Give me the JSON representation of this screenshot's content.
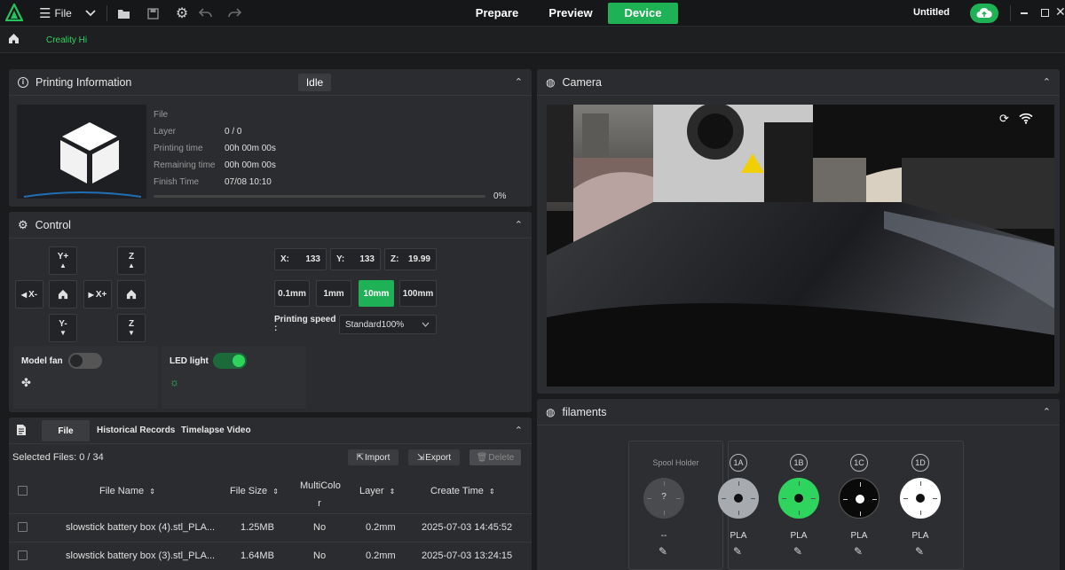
{
  "topbar": {
    "menu_label": "File",
    "tabs": [
      {
        "label": "Prepare"
      },
      {
        "label": "Preview"
      },
      {
        "label": "Device"
      }
    ],
    "project_title": "Untitled"
  },
  "subbar": {
    "printer_tab": "Creality Hi"
  },
  "printing_info": {
    "title": "Printing Information",
    "status": "Idle",
    "labels": {
      "file": "File",
      "layer": "Layer",
      "printing_time": "Printing time",
      "remaining_time": "Remaining time",
      "finish_time": "Finish Time"
    },
    "values": {
      "layer": "0 / 0",
      "printing_time": "00h 00m 00s",
      "remaining_time": "00h 00m 00s",
      "finish_time": "07/08 10:10"
    },
    "progress_text": "0%",
    "progress_fraction": 0
  },
  "control": {
    "title": "Control",
    "jog": {
      "y_plus": "Y+",
      "y_minus": "Y-",
      "x_minus": "X-",
      "x_plus": "X+",
      "z_up": "Z",
      "z_down": "Z"
    },
    "coords": [
      {
        "axis": "X:",
        "value": "133"
      },
      {
        "axis": "Y:",
        "value": "133"
      },
      {
        "axis": "Z:",
        "value": "19.99"
      }
    ],
    "steps": [
      "0.1mm",
      "1mm",
      "10mm",
      "100mm"
    ],
    "active_step": "10mm",
    "speed_label": "Printing speed",
    "speed_colon": ":",
    "speed_value": "Standard100%",
    "model_fan_label": "Model fan",
    "model_fan_on": false,
    "led_label": "LED light",
    "led_on": true
  },
  "files": {
    "tabs": [
      "File",
      "Historical Records",
      "Timelapse Video"
    ],
    "selected_text": "Selected Files: 0 / 34",
    "import_label": "Import",
    "export_label": "Export",
    "delete_label": "Delete",
    "columns": {
      "name": "File Name",
      "size": "File Size",
      "multicolor_1": "MultiColo",
      "multicolor_2": "r",
      "layer": "Layer",
      "created": "Create Time"
    },
    "rows": [
      {
        "name": "slowstick battery box (4).stl_PLA...",
        "size": "1.25MB",
        "multicolor": "No",
        "layer": "0.2mm",
        "created": "2025-07-03 14:45:52"
      },
      {
        "name": "slowstick battery box (3).stl_PLA...",
        "size": "1.64MB",
        "multicolor": "No",
        "layer": "0.2mm",
        "created": "2025-07-03 13:24:15"
      }
    ]
  },
  "camera": {
    "title": "Camera"
  },
  "filaments": {
    "title": "filaments",
    "spool_holder_label": "Spool Holder",
    "spool_unknown": "?",
    "spool_material": "--",
    "slots": [
      {
        "id": "1A",
        "material": "PLA",
        "color": "#a7aaae"
      },
      {
        "id": "1B",
        "material": "PLA",
        "color": "#2fd45f"
      },
      {
        "id": "1C",
        "material": "PLA",
        "color": "#0a0a0a"
      },
      {
        "id": "1D",
        "material": "PLA",
        "color": "#ffffff"
      }
    ]
  },
  "colors": {
    "accent": "#1fb155",
    "panel": "#2b2c2f",
    "background": "#1a1b1d"
  }
}
